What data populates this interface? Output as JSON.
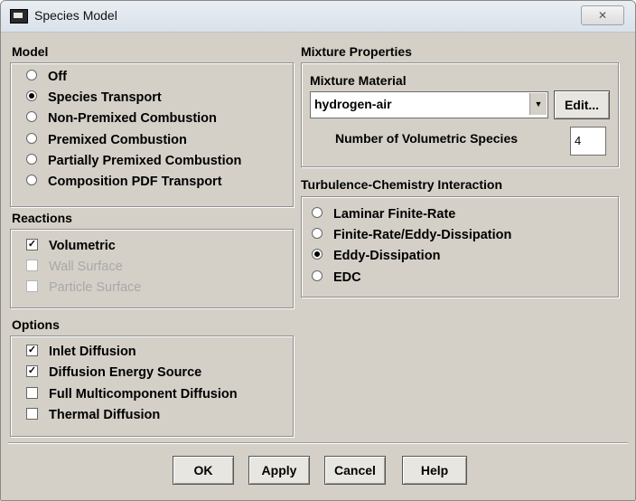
{
  "window": {
    "title": "Species Model",
    "close_label": "✕"
  },
  "model": {
    "label": "Model",
    "options": [
      {
        "label": "Off",
        "selected": false
      },
      {
        "label": "Species Transport",
        "selected": true
      },
      {
        "label": "Non-Premixed Combustion",
        "selected": false
      },
      {
        "label": "Premixed Combustion",
        "selected": false
      },
      {
        "label": "Partially Premixed Combustion",
        "selected": false
      },
      {
        "label": "Composition PDF Transport",
        "selected": false
      }
    ]
  },
  "reactions": {
    "label": "Reactions",
    "items": [
      {
        "label": "Volumetric",
        "checked": true,
        "enabled": true
      },
      {
        "label": "Wall Surface",
        "checked": false,
        "enabled": false
      },
      {
        "label": "Particle Surface",
        "checked": false,
        "enabled": false
      }
    ]
  },
  "options": {
    "label": "Options",
    "items": [
      {
        "label": "Inlet Diffusion",
        "checked": true
      },
      {
        "label": "Diffusion Energy Source",
        "checked": true
      },
      {
        "label": "Full Multicomponent Diffusion",
        "checked": false
      },
      {
        "label": "Thermal Diffusion",
        "checked": false
      }
    ]
  },
  "mixture": {
    "label": "Mixture Properties",
    "material_label": "Mixture Material",
    "material_value": "hydrogen-air",
    "edit_label": "Edit...",
    "species_label": "Number of Volumetric Species",
    "species_value": "4"
  },
  "tci": {
    "label": "Turbulence-Chemistry Interaction",
    "options": [
      {
        "label": "Laminar Finite-Rate",
        "selected": false
      },
      {
        "label": "Finite-Rate/Eddy-Dissipation",
        "selected": false
      },
      {
        "label": "Eddy-Dissipation",
        "selected": true
      },
      {
        "label": "EDC",
        "selected": false
      }
    ]
  },
  "buttons": {
    "ok": "OK",
    "apply": "Apply",
    "cancel": "Cancel",
    "help": "Help"
  },
  "colors": {
    "dialog_bg": "#d4d0c8",
    "titlebar": "#e0e7ee"
  }
}
